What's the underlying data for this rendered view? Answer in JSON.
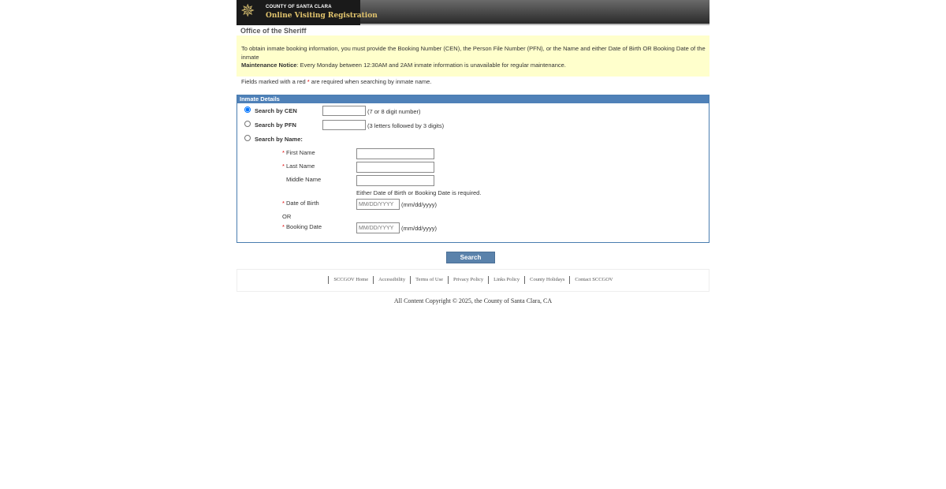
{
  "header": {
    "logo_line1": "COUNTY OF SANTA CLARA",
    "logo_line2": "Online Visiting Registration",
    "logo_icon": "sheriff-star-icon"
  },
  "office_title": "Office of the Sheriff",
  "notice": {
    "intro": "To obtain inmate booking information, you must provide the Booking Number (CEN), the Person File Number (PFN), or the Name and either Date of Birth OR Booking Date of the inmate",
    "maintenance_label": "Maintenance Notice",
    "maintenance_text": ": Every Monday between 12:30AM and 2AM inmate information is unavailable for regular maintenance."
  },
  "required_note": {
    "before": "Fields marked with a red ",
    "star": "*",
    "after": " are required when searching by inmate name."
  },
  "panel": {
    "title": "Inmate Details",
    "cen": {
      "label": "Search by CEN",
      "hint": "(7 or 8 digit number)",
      "value": "",
      "selected": true
    },
    "pfn": {
      "label": "Search by PFN",
      "hint": "(3 letters followed by 3 digits)",
      "value": ""
    },
    "name": {
      "label": "Search by Name:"
    },
    "first_name": {
      "star": "*",
      "label": "First Name",
      "value": ""
    },
    "last_name": {
      "star": "*",
      "label": "Last Name",
      "value": ""
    },
    "middle_name": {
      "label": "Middle Name",
      "value": ""
    },
    "either_note": "Either Date of Birth or Booking Date is required.",
    "dob": {
      "star": "*",
      "label": "Date of Birth",
      "placeholder": "MM/DD/YYYY",
      "hint": "(mm/dd/yyyy)"
    },
    "or_label": "OR",
    "booking_date": {
      "star": "*",
      "label": "Booking Date",
      "placeholder": "MM/DD/YYYY",
      "hint": "(mm/dd/yyyy)"
    }
  },
  "search_button": "Search",
  "footer": {
    "links": [
      "SCCGOV Home",
      "Accessibility",
      "Terms of Use",
      "Privacy Policy",
      "Links Policy",
      "County Holidays",
      "Contact SCCGOV"
    ],
    "copyright": "All Content Copyright © 2025, the County of Santa Clara, CA"
  },
  "colors": {
    "panel_header": "#4f81b8",
    "notice_bg": "#ffffcc",
    "required_star": "#dd0000",
    "button": "#5a82ab"
  }
}
